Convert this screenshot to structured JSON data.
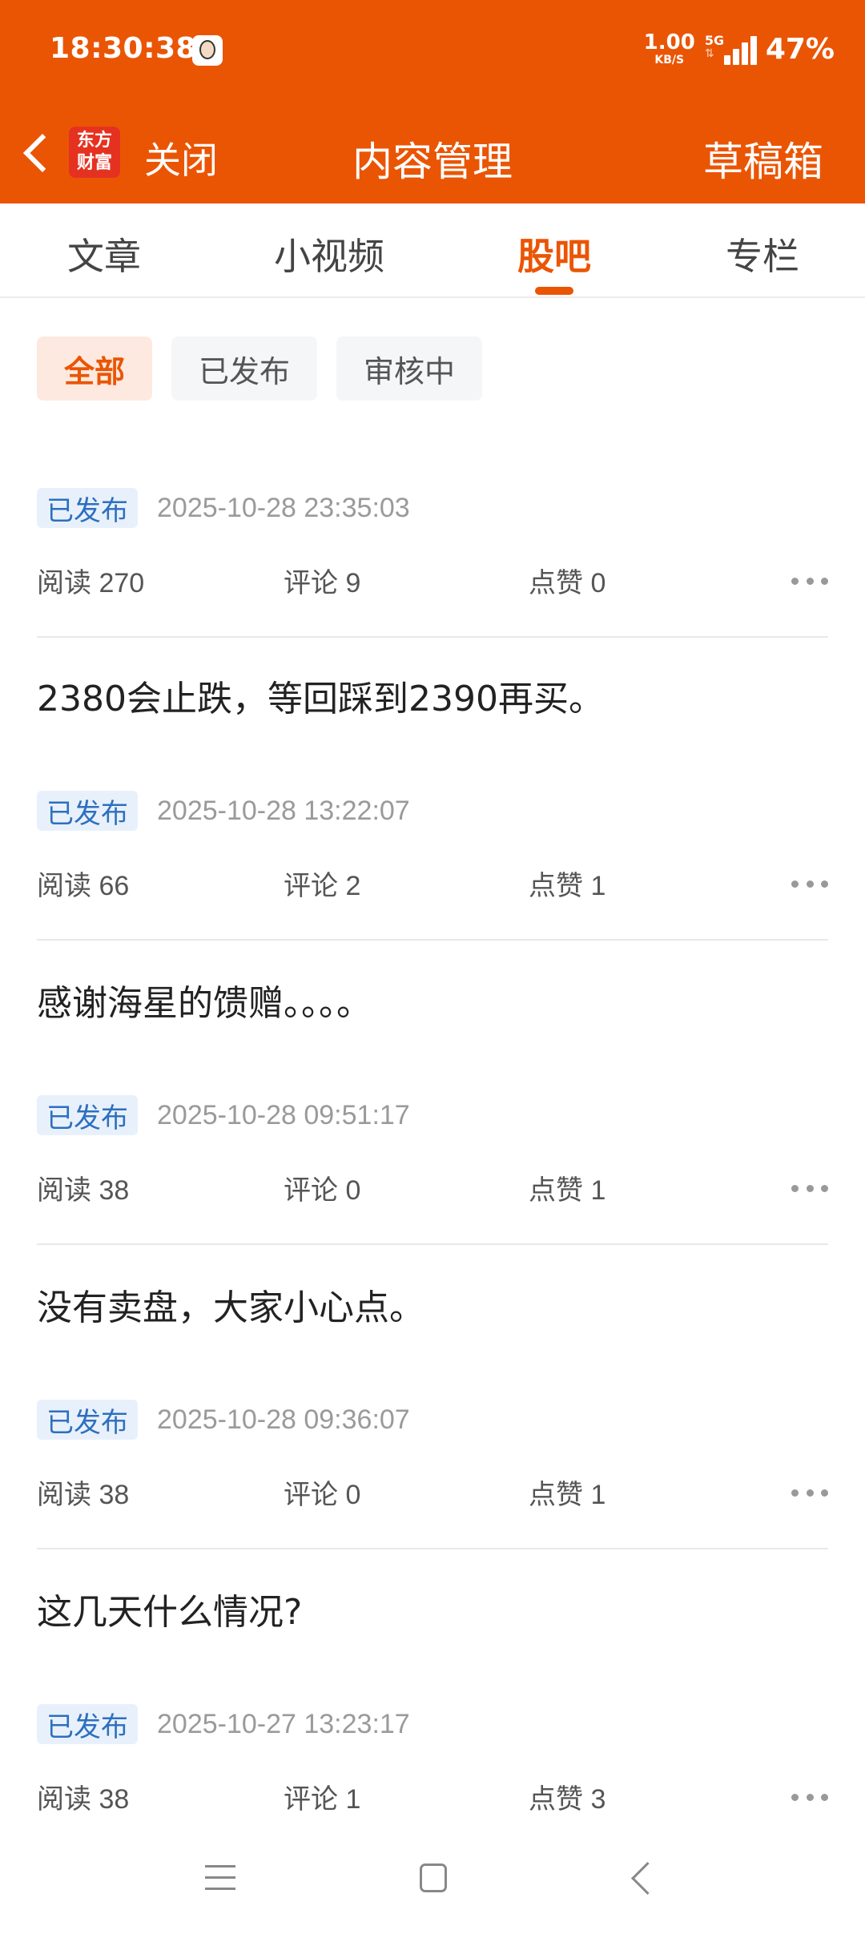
{
  "status_bar": {
    "time": "18:30:38",
    "net_speed_value": "1.00",
    "net_speed_unit": "KB/S",
    "network_type": "5G",
    "battery": "47%"
  },
  "header": {
    "logo_line1": "东方",
    "logo_line2": "财富",
    "close_label": "关闭",
    "title": "内容管理",
    "drafts_label": "草稿箱"
  },
  "tabs": [
    {
      "label": "文章"
    },
    {
      "label": "小视频"
    },
    {
      "label": "股吧"
    },
    {
      "label": "专栏"
    }
  ],
  "active_tab": "股吧",
  "filters": [
    {
      "label": "全部"
    },
    {
      "label": "已发布"
    },
    {
      "label": "审核中"
    }
  ],
  "active_filter": "全部",
  "posts": [
    {
      "text": "",
      "status": "已发布",
      "date": "2025-10-28 23:35:03",
      "reads": "阅读 270",
      "comments": "评论 9",
      "likes": "点赞 0"
    },
    {
      "text": "2380会止跌，等回踩到2390再买。",
      "status": "已发布",
      "date": "2025-10-28 13:22:07",
      "reads": "阅读 66",
      "comments": "评论 2",
      "likes": "点赞 1"
    },
    {
      "text": "感谢海星的馈赠。。。。",
      "status": "已发布",
      "date": "2025-10-28 09:51:17",
      "reads": "阅读 38",
      "comments": "评论 0",
      "likes": "点赞 1"
    },
    {
      "text": "没有卖盘，大家小心点。",
      "status": "已发布",
      "date": "2025-10-28 09:36:07",
      "reads": "阅读 38",
      "comments": "评论 0",
      "likes": "点赞 1"
    },
    {
      "text": "这几天什么情况?",
      "status": "已发布",
      "date": "2025-10-27 13:23:17",
      "reads": "阅读 38",
      "comments": "评论 1",
      "likes": "点赞 3"
    }
  ],
  "colors": {
    "brand": "#EA5504",
    "badge_bg": "#E8F1FB",
    "badge_text": "#2E6FBF"
  }
}
